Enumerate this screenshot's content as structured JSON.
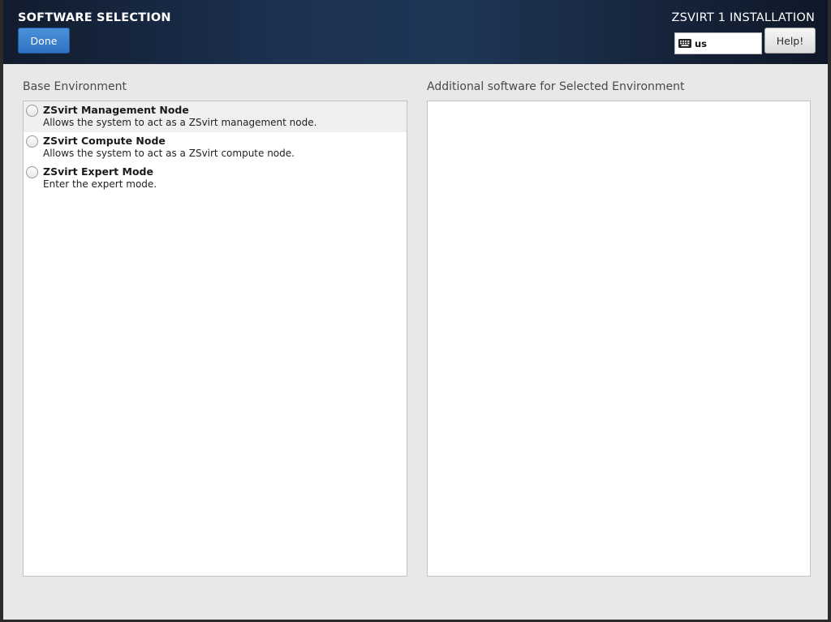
{
  "header": {
    "title": "SOFTWARE SELECTION",
    "done_label": "Done",
    "product_title": "ZSVIRT 1 INSTALLATION",
    "keyboard_layout": "us",
    "keyboard_icon": "keyboard-icon",
    "help_label": "Help!"
  },
  "base_environment": {
    "label": "Base Environment",
    "items": [
      {
        "name": "ZSvirt Management Node",
        "description": "Allows the system to act as a ZSvirt management node.",
        "selected": false
      },
      {
        "name": "ZSvirt Compute Node",
        "description": "Allows the system to act as a ZSvirt compute node.",
        "selected": false
      },
      {
        "name": "ZSvirt Expert Mode",
        "description": "Enter the expert mode.",
        "selected": false
      }
    ]
  },
  "additional_software": {
    "label": "Additional software for Selected Environment",
    "items": []
  },
  "colors": {
    "header_bg": "#1d3152",
    "done_button": "#3a82cf",
    "window_bg": "#e8e8e7"
  }
}
